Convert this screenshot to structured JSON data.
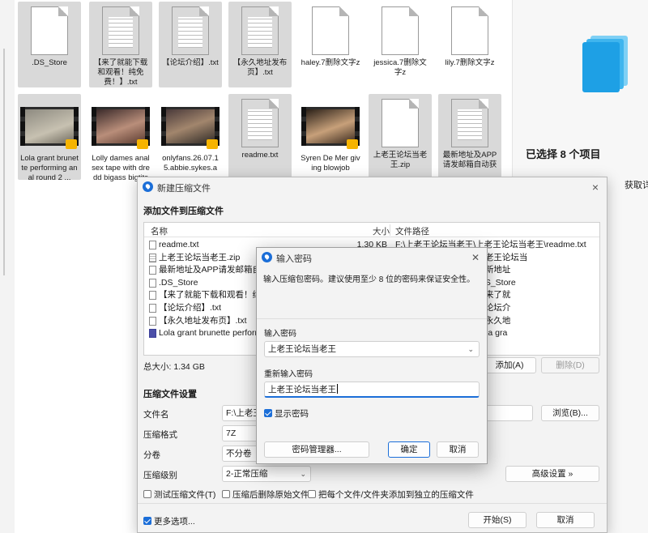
{
  "explorer": {
    "files": [
      {
        "name": ".DS_Store",
        "kind": "doc",
        "selected": true
      },
      {
        "name": "【来了就能下载和观看！纯免费！】.txt",
        "kind": "lines",
        "selected": true
      },
      {
        "name": "【论坛介绍】.txt",
        "kind": "lines",
        "selected": true
      },
      {
        "name": "【永久地址发布页】.txt",
        "kind": "lines",
        "selected": true
      },
      {
        "name": "haley.7删除文字z",
        "kind": "doc",
        "selected": false
      },
      {
        "name": "jessica.7删除文字z",
        "kind": "doc",
        "selected": false
      },
      {
        "name": "lily.7删除文字z",
        "kind": "doc",
        "selected": false
      },
      {
        "name": "Lola grant brunette performing anal round 2 ...",
        "kind": "video",
        "selected": true
      },
      {
        "name": "Lolly dames anal sex tape with dredd bigass bigtits",
        "kind": "video",
        "selected": false
      },
      {
        "name": "onlyfans.26.07.15.abbie.sykes.a",
        "kind": "video",
        "selected": false
      },
      {
        "name": "readme.txt",
        "kind": "lines",
        "selected": true
      },
      {
        "name": "Syren De Mer giving blowjob",
        "kind": "video",
        "selected": false
      },
      {
        "name": "上老王论坛当老王.zip",
        "kind": "doc",
        "selected": true
      },
      {
        "name": "最新地址及APP请发邮箱自动获",
        "kind": "lines",
        "selected": true
      }
    ],
    "details": {
      "selected_count": "已选择 8 个项目",
      "more_link": "获取详细信"
    }
  },
  "main_dialog": {
    "title": "新建压缩文件",
    "close_glyph": "×",
    "add_section": "添加文件到压缩文件",
    "columns": {
      "name": "名称",
      "size": "大小",
      "path": "文件路径"
    },
    "rows": [
      {
        "icon": "doc",
        "name": "readme.txt",
        "size": "1.30 KB",
        "path": "F:\\上老王论坛当老王\\上老王论坛当老王\\readme.txt"
      },
      {
        "icon": "zip",
        "name": "上老王论坛当老王.zip",
        "size": "",
        "path": "王\\上老王论坛当老王\\上老王论坛当"
      },
      {
        "icon": "doc",
        "name": "最新地址及APP请发邮箱自动获",
        "size": "",
        "path": "王\\上老王论坛当老王\\最新地址"
      },
      {
        "icon": "doc",
        "name": ".DS_Store",
        "size": "",
        "path": "王\\上老王论坛当老王\\.DS_Store"
      },
      {
        "icon": "doc",
        "name": "【来了就能下载和观看！纯免费",
        "size": "",
        "path": "王\\上老王论坛当老王\\【来了就"
      },
      {
        "icon": "doc",
        "name": "【论坛介绍】.txt",
        "size": "",
        "path": "王\\上老王论坛当老王\\【论坛介"
      },
      {
        "icon": "doc",
        "name": "【永久地址发布页】.txt",
        "size": "",
        "path": "王\\上老王论坛当老王\\【永久地"
      },
      {
        "icon": "vid",
        "name": "Lola grant brunette performing",
        "size": "",
        "path": "王\\上老王论坛当老王\\Lola gra"
      }
    ],
    "total_size": "总大小: 1.34 GB",
    "add_button": "添加(A)",
    "delete_button": "删除(D)",
    "settings_heading": "压缩文件设置",
    "labels": {
      "filename": "文件名",
      "format": "压缩格式",
      "split": "分卷",
      "level": "压缩级别"
    },
    "filename_value": "F:\\上老王论",
    "format_value": "7Z",
    "split_value": "不分卷",
    "level_value": "2-正常压缩",
    "browse_button": "浏览(B)...",
    "advanced_button": "高级设置 »",
    "checks": {
      "test": "测试压缩文件(T)",
      "delete_after": "压缩后删除原始文件",
      "each_separate": "把每个文件/文件夹添加到独立的压缩文件"
    },
    "more_options": "更多选项...",
    "start_button": "开始(S)",
    "cancel_button": "取消"
  },
  "password_dialog": {
    "title": "输入密码",
    "close_glyph": "✕",
    "note": "输入压缩包密码。建议使用至少 8 位的密码来保证安全性。",
    "enter_label": "输入密码",
    "enter_value": "上老王论坛当老王",
    "reenter_label": "重新输入密码",
    "reenter_value": "上老王论坛当老王",
    "show_password": "显示密码",
    "manager_button": "密码管理器...",
    "ok_button": "确定",
    "cancel_button": "取消"
  }
}
